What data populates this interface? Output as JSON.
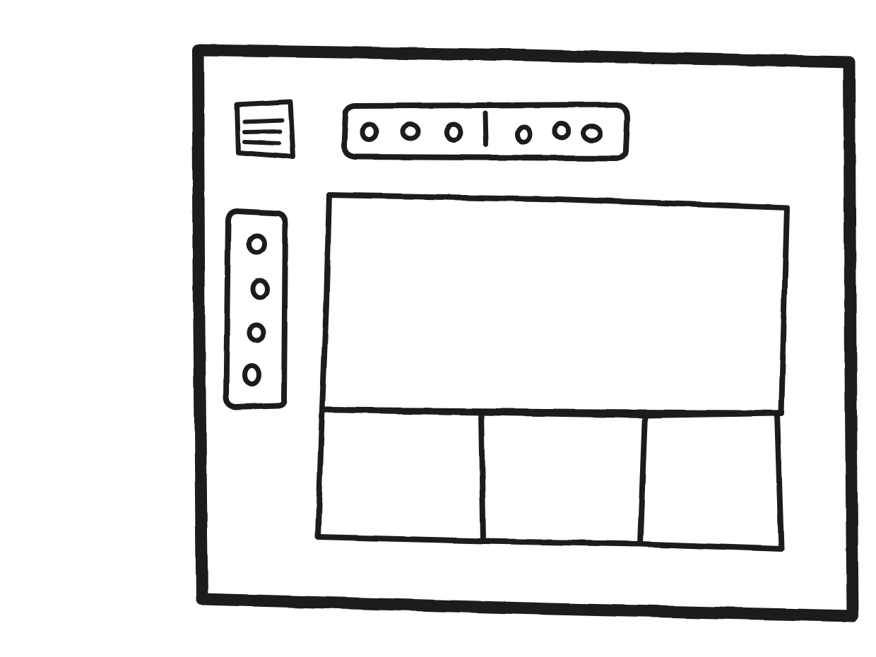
{
  "wireframe": {
    "ink_color": "#1a1a1a",
    "paper_color": "#ffffff",
    "menu_button": {
      "icon": "hamburger-menu-icon",
      "line_count": 3
    },
    "top_toolbar": {
      "left_group": {
        "icon_count": 3
      },
      "right_group": {
        "icon_count": 3
      },
      "has_divider": true
    },
    "side_toolbar": {
      "icon_count": 4
    },
    "content": {
      "main_panel": 1,
      "bottom_panel_count": 3
    }
  }
}
